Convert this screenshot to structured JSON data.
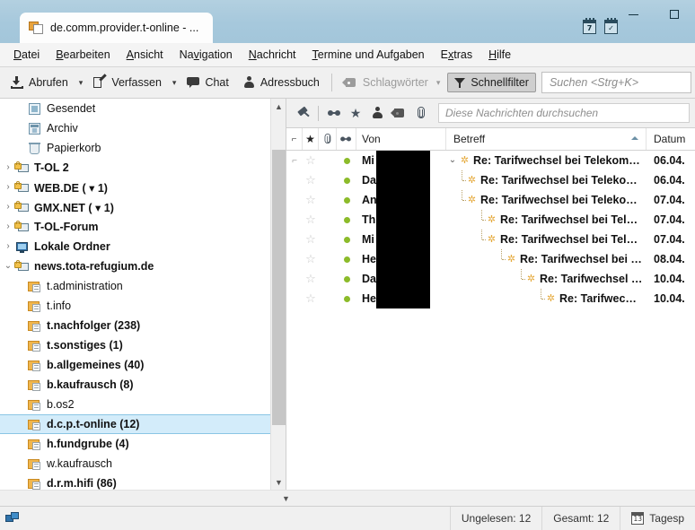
{
  "window": {
    "tab_title": "de.comm.provider.t-online - ...",
    "tab_icon": "newsgroup-icon",
    "minimize_label": "–",
    "maximize_label": "□",
    "titlebar_icons": [
      {
        "name": "calendar-icon",
        "day": "7"
      },
      {
        "name": "tasks-icon",
        "day": "✓"
      }
    ]
  },
  "menubar": {
    "items": [
      {
        "label": "Datei",
        "accel": "D"
      },
      {
        "label": "Bearbeiten",
        "accel": "B"
      },
      {
        "label": "Ansicht",
        "accel": "A"
      },
      {
        "label": "Navigation",
        "accel": "v"
      },
      {
        "label": "Nachricht",
        "accel": "N"
      },
      {
        "label": "Termine und Aufgaben",
        "accel": "T"
      },
      {
        "label": "Extras",
        "accel": "x"
      },
      {
        "label": "Hilfe",
        "accel": "H"
      }
    ]
  },
  "toolbar": {
    "get_messages": "Abrufen",
    "compose": "Verfassen",
    "chat": "Chat",
    "addressbook": "Adressbuch",
    "tags": "Schlagwörter",
    "quickfilter": "Schnellfilter",
    "search_placeholder": "Suchen <Strg+K>"
  },
  "quickfilter_bar": {
    "buttons": [
      {
        "name": "pin-icon",
        "title": "Angeheftet"
      },
      {
        "name": "unread-icon",
        "title": "Ungelesen"
      },
      {
        "name": "star-icon",
        "title": "Gekennzeichnet"
      },
      {
        "name": "contact-icon",
        "title": "Kontakt"
      },
      {
        "name": "tag-icon",
        "title": "Schlagwort"
      },
      {
        "name": "attachment-icon",
        "title": "Anhang"
      }
    ],
    "search_placeholder": "Diese Nachrichten durchsuchen"
  },
  "folder_pane": {
    "items": [
      {
        "label": "Gesendet",
        "icon": "sent-icon",
        "indent": 1,
        "twisty": "",
        "bold": false,
        "selected": false
      },
      {
        "label": "Archiv",
        "icon": "archive-icon",
        "indent": 1,
        "twisty": "",
        "bold": false,
        "selected": false
      },
      {
        "label": "Papierkorb",
        "icon": "trash-icon",
        "indent": 1,
        "twisty": "",
        "bold": false,
        "selected": false
      },
      {
        "label": "T-OL 2",
        "icon": "account-icon",
        "indent": 0,
        "twisty": "›",
        "bold": true,
        "selected": false
      },
      {
        "label": "WEB.DE ( ▾ 1)",
        "icon": "account-icon",
        "indent": 0,
        "twisty": "›",
        "bold": true,
        "selected": false
      },
      {
        "label": "GMX.NET ( ▾ 1)",
        "icon": "account-icon",
        "indent": 0,
        "twisty": "›",
        "bold": true,
        "selected": false
      },
      {
        "label": "T-OL-Forum",
        "icon": "account-icon",
        "indent": 0,
        "twisty": "›",
        "bold": true,
        "selected": false
      },
      {
        "label": "Lokale Ordner",
        "icon": "local-folders-icon",
        "indent": 0,
        "twisty": "›",
        "bold": true,
        "selected": false
      },
      {
        "label": "news.tota-refugium.de",
        "icon": "account-icon",
        "indent": 0,
        "twisty": "⌄",
        "bold": true,
        "selected": false
      },
      {
        "label": "t.administration",
        "icon": "newsgroup-icon",
        "indent": 1,
        "twisty": "",
        "bold": false,
        "selected": false
      },
      {
        "label": "t.info",
        "icon": "newsgroup-icon",
        "indent": 1,
        "twisty": "",
        "bold": false,
        "selected": false
      },
      {
        "label": "t.nachfolger (238)",
        "icon": "newsgroup-icon",
        "indent": 1,
        "twisty": "",
        "bold": true,
        "selected": false
      },
      {
        "label": "t.sonstiges (1)",
        "icon": "newsgroup-icon",
        "indent": 1,
        "twisty": "",
        "bold": true,
        "selected": false
      },
      {
        "label": "b.allgemeines (40)",
        "icon": "newsgroup-icon",
        "indent": 1,
        "twisty": "",
        "bold": true,
        "selected": false
      },
      {
        "label": "b.kaufrausch (8)",
        "icon": "newsgroup-icon",
        "indent": 1,
        "twisty": "",
        "bold": true,
        "selected": false
      },
      {
        "label": "b.os2",
        "icon": "newsgroup-icon",
        "indent": 1,
        "twisty": "",
        "bold": false,
        "selected": false
      },
      {
        "label": "d.c.p.t-online (12)",
        "icon": "newsgroup-icon",
        "indent": 1,
        "twisty": "",
        "bold": true,
        "selected": true
      },
      {
        "label": "h.fundgrube (4)",
        "icon": "newsgroup-icon",
        "indent": 1,
        "twisty": "",
        "bold": true,
        "selected": false
      },
      {
        "label": "w.kaufrausch",
        "icon": "newsgroup-icon",
        "indent": 1,
        "twisty": "",
        "bold": false,
        "selected": false
      },
      {
        "label": "d.r.m.hifi (86)",
        "icon": "newsgroup-icon",
        "indent": 1,
        "twisty": "",
        "bold": true,
        "selected": false
      }
    ]
  },
  "message_list": {
    "columns": {
      "thread": "⌐",
      "star": "★",
      "attachment": "clip-icon",
      "unread": "unread-icon",
      "from": "Von",
      "subject": "Betreff",
      "date": "Datum"
    },
    "sort": {
      "column": "Betreff",
      "direction": "asc"
    },
    "rows": [
      {
        "from": "Mi",
        "subject": "Re: Tarifwechsel bei Telekom nicht ...",
        "date": "06.04.",
        "depth": 0,
        "unread": true,
        "twisty": "⌄",
        "redact_width": 60
      },
      {
        "from": "Da",
        "subject": "Re: Tarifwechsel bei Telekom nich...",
        "date": "06.04.",
        "depth": 1,
        "unread": true,
        "twisty": "",
        "redact_width": 60
      },
      {
        "from": "An",
        "subject": "Re: Tarifwechsel bei Telekom nich...",
        "date": "07.04.",
        "depth": 1,
        "unread": true,
        "twisty": "",
        "redact_width": 60
      },
      {
        "from": "Th",
        "subject": "Re: Tarifwechsel bei Telekom ni...",
        "date": "07.04.",
        "depth": 2,
        "unread": true,
        "twisty": "",
        "redact_width": 60
      },
      {
        "from": "Mi",
        "subject": "Re: Tarifwechsel bei Telekom ni...",
        "date": "07.04.",
        "depth": 2,
        "unread": true,
        "twisty": "",
        "redact_width": 60
      },
      {
        "from": "He",
        "subject": "Re: Tarifwechsel bei Telekom ...",
        "date": "08.04.",
        "depth": 3,
        "unread": true,
        "twisty": "",
        "redact_width": 60
      },
      {
        "from": "Da",
        "subject": "Re: Tarifwechsel bei Teleko...",
        "date": "10.04.",
        "depth": 4,
        "unread": true,
        "twisty": "",
        "redact_width": 60
      },
      {
        "from": "He",
        "subject": "Re: Tarifwechsel bei Tele...",
        "date": "10.04.",
        "depth": 5,
        "unread": true,
        "twisty": "",
        "redact_width": 60
      }
    ]
  },
  "statusbar": {
    "network_icon": "network-icon",
    "unread": "Ungelesen: 12",
    "total": "Gesamt: 12",
    "today_pane": "Tagesp",
    "today_pane_day": "13"
  },
  "colors": {
    "titlebar": "#a8cadd",
    "selection": "#d3ecfa",
    "selection_border": "#8ac5e4",
    "unread_dot": "#8cbb2a",
    "thread_line": "#b9a26a",
    "newsgroup_icon": "#e5a93b",
    "toolbar_bg": "#f0f0f0"
  }
}
